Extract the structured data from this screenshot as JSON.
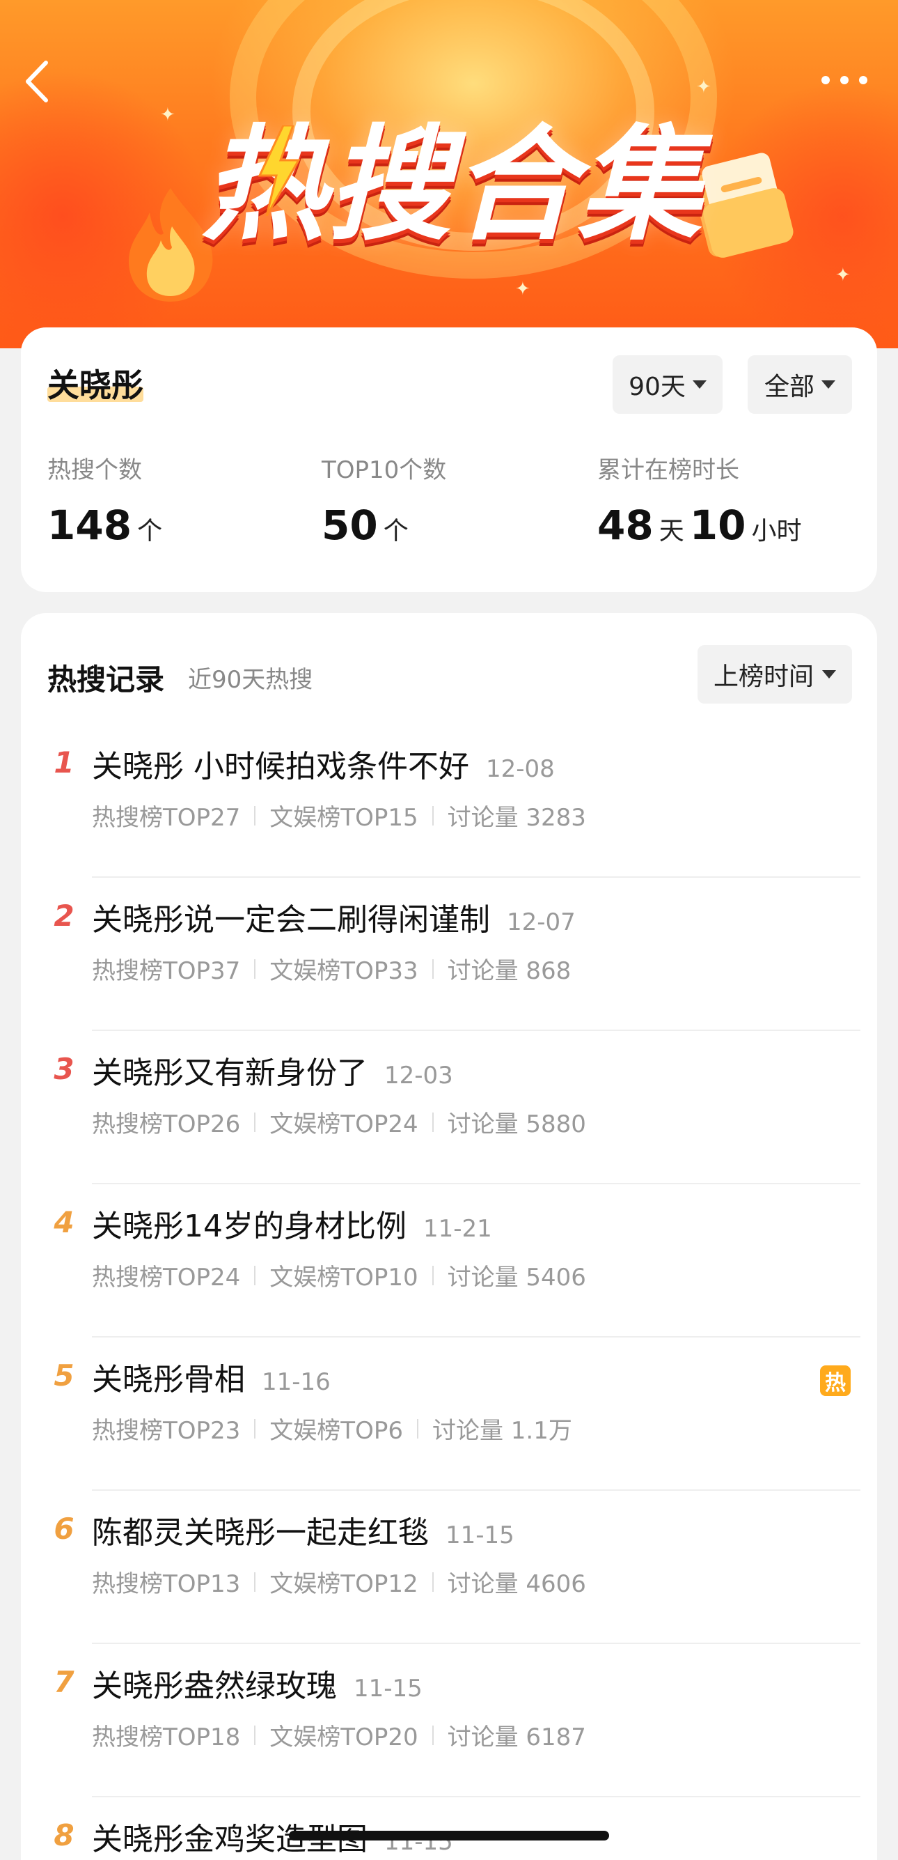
{
  "banner": {
    "title": "热搜合集"
  },
  "stats": {
    "name": "关晓彤",
    "range_filter": "90天",
    "scope_filter": "全部",
    "hot_count_label": "热搜个数",
    "hot_count": "148",
    "hot_count_unit": "个",
    "top10_label": "TOP10个数",
    "top10_count": "50",
    "top10_unit": "个",
    "duration_label": "累计在榜时长",
    "duration_days": "48",
    "duration_days_unit": "天",
    "duration_hours": "10",
    "duration_hours_unit": "小时"
  },
  "records": {
    "title": "热搜记录",
    "subtitle": "近90天热搜",
    "sort_label": "上榜时间",
    "items": [
      {
        "rank": "1",
        "title": "关晓彤 小时候拍戏条件不好",
        "date": "12-08",
        "hot": "热搜榜TOP27",
        "ent": "文娱榜TOP15",
        "discuss": "讨论量 3283"
      },
      {
        "rank": "2",
        "title": "关晓彤说一定会二刷得闲谨制",
        "date": "12-07",
        "hot": "热搜榜TOP37",
        "ent": "文娱榜TOP33",
        "discuss": "讨论量 868"
      },
      {
        "rank": "3",
        "title": "关晓彤又有新身份了",
        "date": "12-03",
        "hot": "热搜榜TOP26",
        "ent": "文娱榜TOP24",
        "discuss": "讨论量 5880"
      },
      {
        "rank": "4",
        "title": "关晓彤14岁的身材比例",
        "date": "11-21",
        "hot": "热搜榜TOP24",
        "ent": "文娱榜TOP10",
        "discuss": "讨论量 5406"
      },
      {
        "rank": "5",
        "title": "关晓彤骨相",
        "date": "11-16",
        "hot": "热搜榜TOP23",
        "ent": "文娱榜TOP6",
        "discuss": "讨论量 1.1万",
        "badge": "热"
      },
      {
        "rank": "6",
        "title": "陈都灵关晓彤一起走红毯",
        "date": "11-15",
        "hot": "热搜榜TOP13",
        "ent": "文娱榜TOP12",
        "discuss": "讨论量 4606"
      },
      {
        "rank": "7",
        "title": "关晓彤盎然绿玫瑰",
        "date": "11-15",
        "hot": "热搜榜TOP18",
        "ent": "文娱榜TOP20",
        "discuss": "讨论量 6187"
      },
      {
        "rank": "8",
        "title": "关晓彤金鸡奖造型图",
        "date": "11-15",
        "hot": "",
        "ent": "",
        "discuss": ""
      }
    ]
  },
  "colors": {
    "rank_top3": "#e8554e",
    "rank_rest": "#f0a040",
    "hot_badge": "#ffaa1c"
  }
}
